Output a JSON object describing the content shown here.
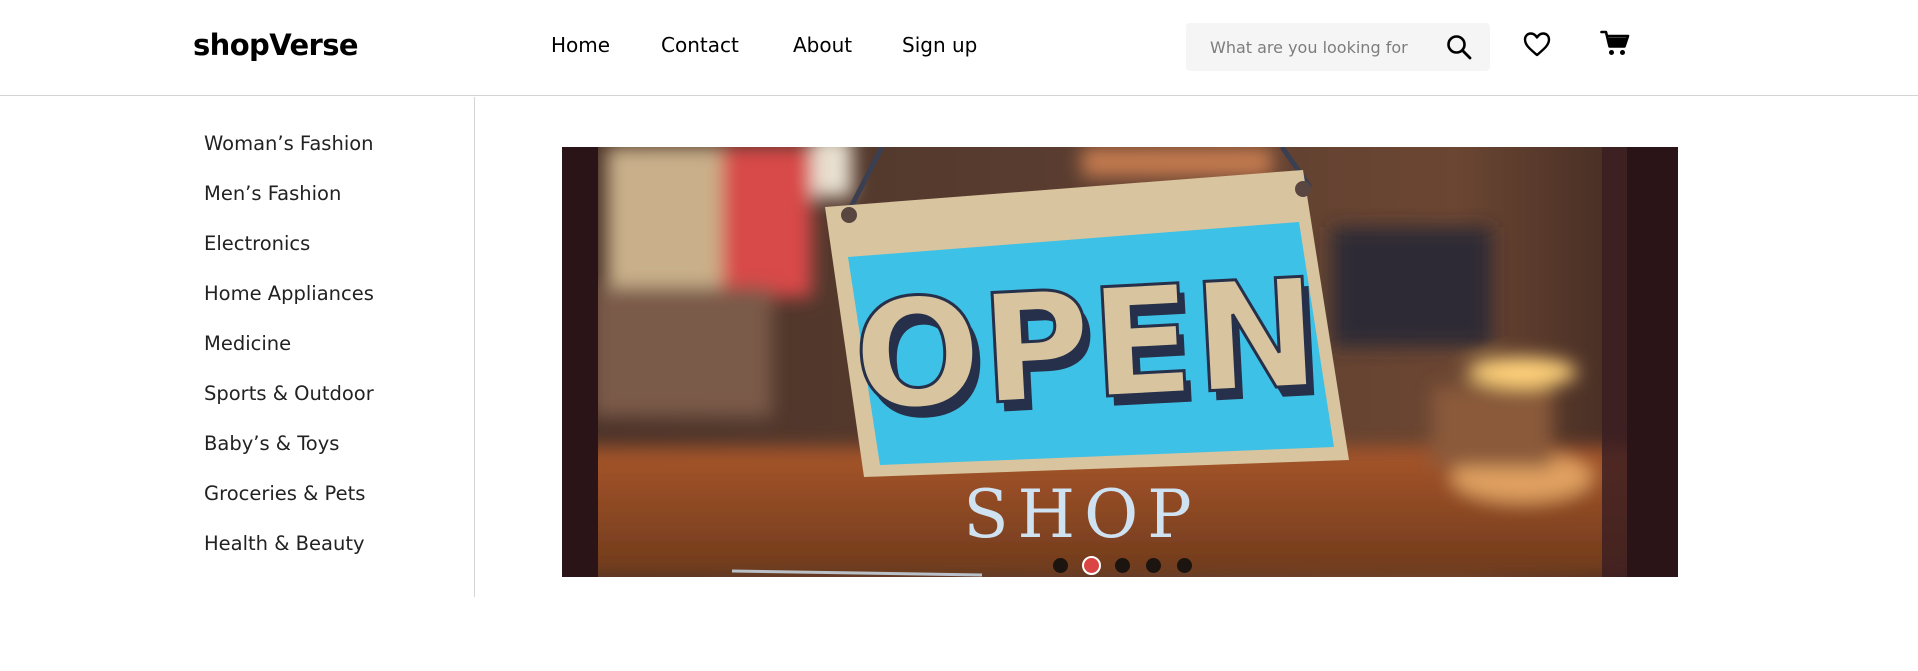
{
  "brand": {
    "name": "shopVerse"
  },
  "nav": {
    "items": [
      {
        "label": "Home"
      },
      {
        "label": "Contact"
      },
      {
        "label": "About"
      },
      {
        "label": "Sign up"
      }
    ]
  },
  "search": {
    "placeholder": "What are you looking for",
    "value": "",
    "icon": "search-icon"
  },
  "actions": {
    "wishlist_icon": "heart-icon",
    "cart_icon": "cart-icon"
  },
  "categories": [
    "Woman’s Fashion",
    "Men’s Fashion",
    "Electronics",
    "Home Appliances",
    "Medicine",
    "Sports & Outdoor",
    "Baby’s & Toys",
    "Groceries & Pets",
    "Health & Beauty"
  ],
  "hero": {
    "sign_text": "OPEN",
    "window_text": "SHOP",
    "slide_count": 5,
    "active_slide": 2
  },
  "colors": {
    "accent": "#DB4444",
    "sign_blue": "#3EC1E6",
    "divider": "#D4D4D4"
  }
}
